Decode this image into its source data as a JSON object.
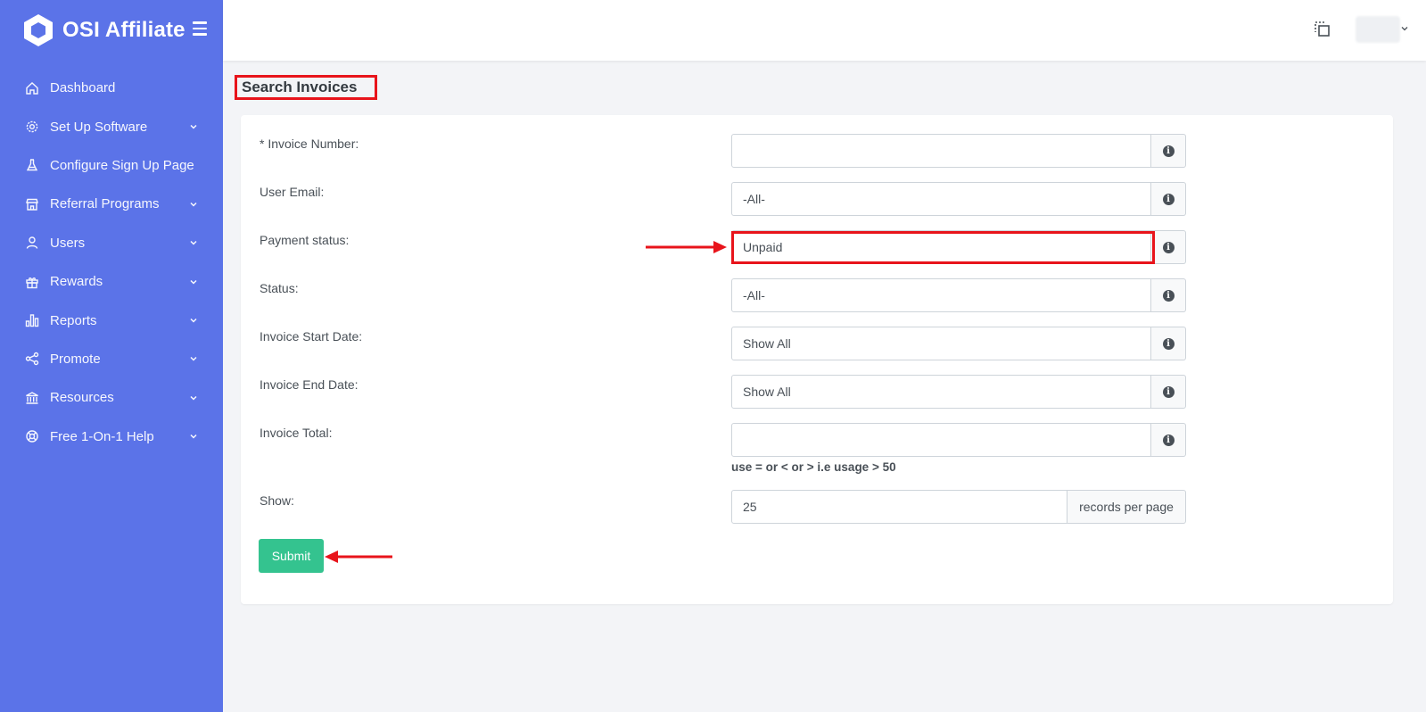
{
  "brand": {
    "name": "OSI Affiliate"
  },
  "sidebar": {
    "items": [
      {
        "label": "Dashboard",
        "icon": "home-icon",
        "has_submenu": false
      },
      {
        "label": "Set Up Software",
        "icon": "gear-icon",
        "has_submenu": true
      },
      {
        "label": "Configure Sign Up Page",
        "icon": "flask-icon",
        "has_submenu": false
      },
      {
        "label": "Referral Programs",
        "icon": "store-icon",
        "has_submenu": true
      },
      {
        "label": "Users",
        "icon": "user-icon",
        "has_submenu": true
      },
      {
        "label": "Rewards",
        "icon": "gift-icon",
        "has_submenu": true
      },
      {
        "label": "Reports",
        "icon": "bar-chart-icon",
        "has_submenu": true
      },
      {
        "label": "Promote",
        "icon": "share-icon",
        "has_submenu": true
      },
      {
        "label": "Resources",
        "icon": "bank-icon",
        "has_submenu": true
      },
      {
        "label": "Free 1-On-1 Help",
        "icon": "lifebuoy-icon",
        "has_submenu": true
      }
    ]
  },
  "page": {
    "title": "Search Invoices"
  },
  "form": {
    "invoice_number": {
      "label": "* Invoice Number:",
      "value": ""
    },
    "user_email": {
      "label": "User Email:",
      "value": "-All-"
    },
    "payment_status": {
      "label": "Payment status:",
      "value": "Unpaid"
    },
    "status": {
      "label": "Status:",
      "value": "-All-"
    },
    "invoice_start_date": {
      "label": "Invoice Start Date:",
      "value": "Show All"
    },
    "invoice_end_date": {
      "label": "Invoice End Date:",
      "value": "Show All"
    },
    "invoice_total": {
      "label": "Invoice Total:",
      "value": "",
      "hint": "use = or < or > i.e usage > 50"
    },
    "show": {
      "label": "Show:",
      "value": "25",
      "suffix": "records per page"
    },
    "submit_label": "Submit"
  },
  "colors": {
    "sidebar": "#5b73e8",
    "submit": "#34c38f",
    "annotation": "#e8141b"
  }
}
